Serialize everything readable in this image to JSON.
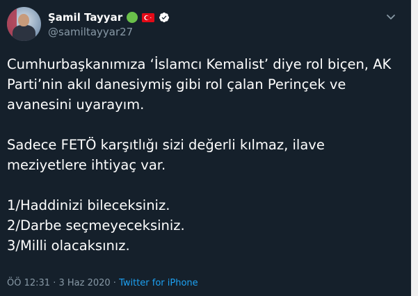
{
  "author": {
    "display_name": "Şamil Tayyar",
    "handle": "@samiltayyar27",
    "status_dot_color": "#6ac04a",
    "flag_icon": "turkey-flag-icon",
    "verified_icon": "verified-badge-icon"
  },
  "tweet": {
    "paragraph_1": [
      "Cumhurbaşkanımıza ‘İslamcı Kemalist’ diye rol biçen, AK",
      "Parti’nin akıl danesiymiş gibi rol çalan Perinçek ve",
      "avanesini uyarayım."
    ],
    "paragraph_2": [
      "Sadece FETÖ karşıtlığı sizi değerli kılmaz, ilave",
      "meziyetlere ihtiyaç var."
    ],
    "paragraph_3": [
      "1/Haddinizi bileceksiniz.",
      "2/Darbe seçmeyeceksiniz.",
      "3/Milli olacaksınız."
    ]
  },
  "footer": {
    "time": "ÖÖ 12:31",
    "separator": " · ",
    "date": "3 Haz 2020",
    "separator2": " · ",
    "source": "Twitter for iPhone"
  },
  "colors": {
    "background": "#15202b",
    "secondary_text": "#8899a6",
    "link": "#1da1f2"
  }
}
